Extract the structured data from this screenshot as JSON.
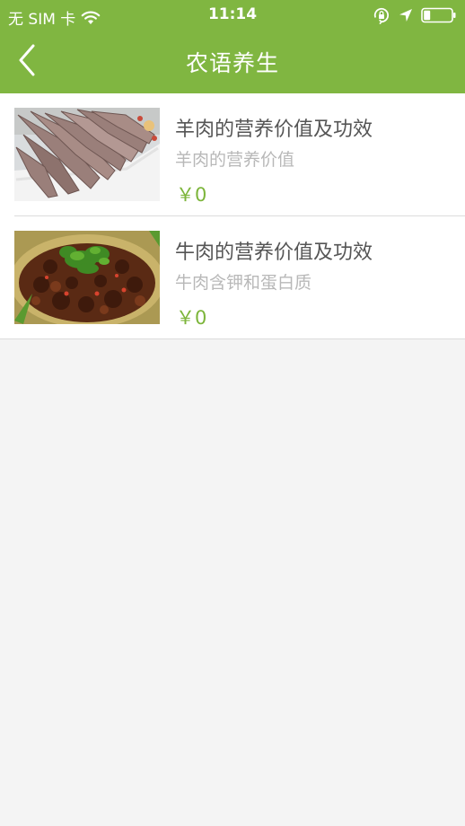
{
  "status_bar": {
    "carrier": "无 SIM 卡",
    "time": "11:14"
  },
  "nav": {
    "title": "农语养生"
  },
  "list": {
    "items": [
      {
        "title": "羊肉的营养价值及功效",
        "subtitle": "羊肉的营养价值",
        "price": "￥0",
        "image_icon": "lamb-dish-photo"
      },
      {
        "title": "牛肉的营养价值及功效",
        "subtitle": "牛肉含钾和蛋白质",
        "price": "￥0",
        "image_icon": "beef-stew-photo"
      }
    ]
  },
  "colors": {
    "brand_green": "#80b641",
    "price_green": "#7cb53a",
    "background": "#f4f4f4"
  }
}
